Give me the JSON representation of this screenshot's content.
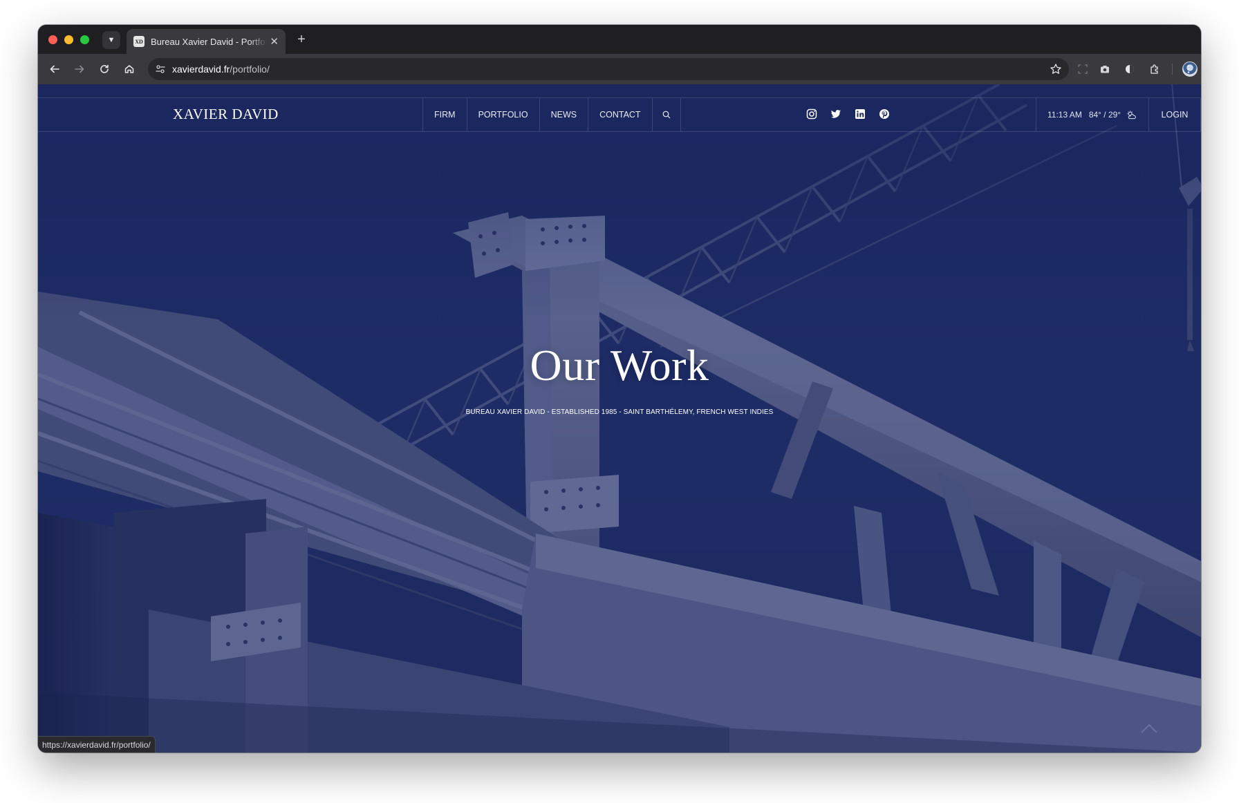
{
  "browser": {
    "tab_title": "Bureau Xavier David - Portfolio",
    "favicon_text": "XD",
    "url_host": "xavierdavid.fr",
    "url_path": "/portfolio/",
    "status_url": "https://xavierdavid.fr/portfolio/"
  },
  "site": {
    "logo": "XAVIER DAVID",
    "nav": [
      "FIRM",
      "PORTFOLIO",
      "NEWS",
      "CONTACT"
    ],
    "social": [
      "instagram-icon",
      "twitter-icon",
      "linkedin-icon",
      "pinterest-icon"
    ],
    "time": "11:13 AM",
    "temperature": "84° / 29°",
    "login": "LOGIN"
  },
  "hero": {
    "title": "Our Work",
    "subtitle": "BUREAU XAVIER DAVID - ESTABLISHED 1985 - SAINT BARTHÉLEMY, FRENCH WEST INDIES"
  },
  "colors": {
    "page_bg": "#1f2c66",
    "steel": "#59618a",
    "chrome": "#3a3a3e"
  }
}
